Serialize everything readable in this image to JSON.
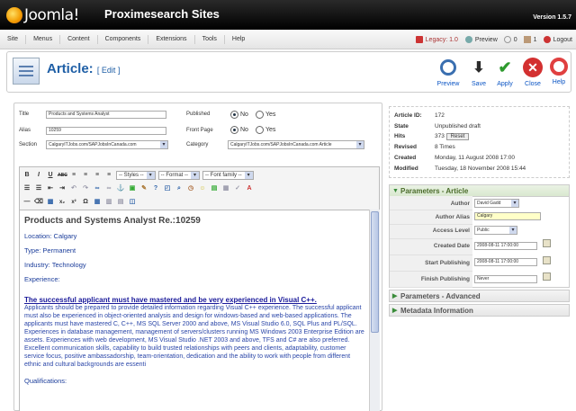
{
  "header": {
    "logo_text": "Joomla!",
    "site_name": "Proximesearch Sites",
    "version": "Version 1.5.7"
  },
  "menu": [
    "Site",
    "Menus",
    "Content",
    "Components",
    "Extensions",
    "Tools",
    "Help"
  ],
  "status": {
    "legacy": "Legacy: 1.0",
    "preview": "Preview",
    "messages": "0",
    "users": "1",
    "logout": "Logout"
  },
  "page": {
    "title": "Article:",
    "subtitle": "[ Edit ]"
  },
  "toolbar": [
    {
      "label": "Preview",
      "icon": "preview-icon",
      "color": "#3a6fb0"
    },
    {
      "label": "Save",
      "icon": "save-icon",
      "color": "#2b2b2b"
    },
    {
      "label": "Apply",
      "icon": "apply-icon",
      "color": "#2e9a2e"
    },
    {
      "label": "Close",
      "icon": "close-icon",
      "color": "#d33030"
    },
    {
      "label": "Help",
      "icon": "help-icon",
      "color": "#e04040"
    }
  ],
  "form": {
    "title_label": "Title",
    "title_value": "Products and Systems Analyst",
    "alias_label": "Alias",
    "alias_value": "10259",
    "section_label": "Section",
    "section_value": "CalgaryITJobs.com/SAPJobsInCanada.com",
    "published_label": "Published",
    "frontpage_label": "Front Page",
    "category_label": "Category",
    "category_value": "CalgaryITJobs.com/SAPJobsInCanada.com Article",
    "no": "No",
    "yes": "Yes"
  },
  "editor": {
    "styles": "-- Styles --",
    "format": "-- Format --",
    "font_family": "-- Font family --"
  },
  "content": {
    "heading": "Products and Systems Analyst  Re.:10259",
    "location": "Location: Calgary",
    "type": "Type: Permanent",
    "industry": "Industry: Technology",
    "experience": "Experience:",
    "bold_line": "The successful applicant must have mastered and be very experienced in Visual C++.",
    "body": "Applicants should be prepared to provide detailed information regarding Visual C++ experience.  The successful applicant must also be experienced in object-oriented analysis and design for windows-based and web-based applications. The applicants must have mastered C, C++, MS SQL Server 2000 and above, MS Visual Studio 6.0, SQL Plus and PL/SQL. Experiences in database management, management of servers/clusters running MS Windows 2003 Enterprise Edition are assets. Experiences with web development, MS Visual Studio .NET 2003 and above, TFS and C# are also preferred. Excellent communication skills, capability to build trusted relationships with peers and clients, adaptability, customer service focus, positive ambassadorship, team-orientation, dedication and the ability to work with people from different ethnic and cultural backgrounds are essenti",
    "qualifications": "Qualifications:"
  },
  "info": {
    "article_id_label": "Article ID:",
    "article_id": "172",
    "state_label": "State",
    "state": "Unpublished draft",
    "hits_label": "Hits",
    "hits": "373",
    "reset": "Reset",
    "revised_label": "Revised",
    "revised": "8 Times",
    "created_label": "Created",
    "created": "Monday, 11 August 2008 17:00",
    "modified_label": "Modified",
    "modified": "Tuesday, 18 November 2008 15:44"
  },
  "params": {
    "header": "Parameters - Article",
    "author_label": "Author",
    "author": "David Gadd",
    "alias_label": "Author Alias",
    "alias": "Calgary",
    "access_label": "Access Level",
    "access": "Public",
    "created_label": "Created Date",
    "created": "2008-08-11 17:00:00",
    "start_label": "Start Publishing",
    "start": "2008-08-11 17:00:00",
    "finish_label": "Finish Publishing",
    "finish": "Never",
    "advanced": "Parameters - Advanced",
    "metadata": "Metadata Information"
  }
}
